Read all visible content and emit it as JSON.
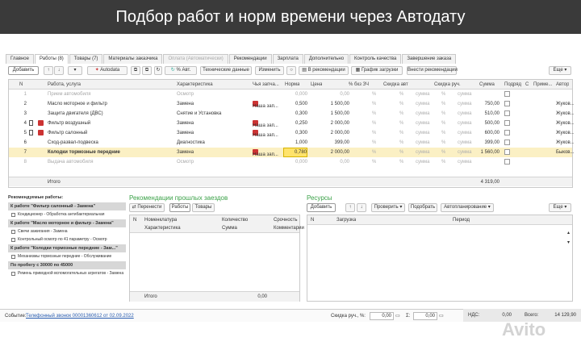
{
  "banner": {
    "title": "Подбор работ и норм времени через Автодату"
  },
  "tabs": [
    "Главное",
    "Работы (8)",
    "Товары (7)",
    "Материалы заказчика",
    "Оплата (Автоматически)",
    "Рекомендации",
    "Зарплата",
    "Дополнительно",
    "Контроль качества",
    "Завершение заказа"
  ],
  "toolbar": {
    "add": "Добавить",
    "autodata": "Autodata",
    "pct": "% Авт.",
    "tech": "Технические данные",
    "change": "Изменить",
    "to_recs": "В рекомендации",
    "schedule": "График загрузки",
    "bring": "Внести рекомендации",
    "more": "Еще"
  },
  "grid": {
    "headers": [
      "N",
      "Работа, услуга",
      "Характеристика",
      "Чья запча...",
      "Норма",
      "Цена",
      "% бкз ЗЧ",
      "Скидка авт",
      "Скидка руч.",
      "Сумма",
      "Подряд",
      "С",
      "Приме...",
      "Автор"
    ],
    "rows": [
      {
        "n": "1",
        "name": "Прием автомобиля",
        "char": "Осмотр",
        "whose": "",
        "norm": "0,000",
        "price": "0,00",
        "pct": "%",
        "disc": "%",
        "sum_auto": "сумма",
        "disc_man": "%",
        "sum_man": "сумма",
        "sum": "",
        "author": ""
      },
      {
        "n": "2",
        "name": "Масло моторное и фильтр",
        "char": "Замена",
        "whose": "Наша зап...",
        "norm": "0,500",
        "price": "1 500,00",
        "pct": "%",
        "disc": "%",
        "sum_auto": "сумма",
        "disc_man": "%",
        "sum_man": "сумма",
        "sum": "750,00",
        "author": "Жуков..."
      },
      {
        "n": "3",
        "name": "Защита двигателя (ДВС)",
        "char": "Снятие и Установка",
        "whose": "",
        "norm": "0,300",
        "price": "1 500,00",
        "pct": "%",
        "disc": "%",
        "sum_auto": "сумма",
        "disc_man": "%",
        "sum_man": "сумма",
        "sum": "510,00",
        "author": "Жуков..."
      },
      {
        "n": "4",
        "name": "Фильтр воздушный",
        "char": "Замена",
        "whose": "Наша зап...",
        "norm": "0,250",
        "price": "2 000,00",
        "pct": "%",
        "disc": "%",
        "sum_auto": "сумма",
        "disc_man": "%",
        "sum_man": "сумма",
        "sum": "500,00",
        "author": "Жуков..."
      },
      {
        "n": "5",
        "name": "Фильтр салонный",
        "char": "Замена",
        "whose": "Наша зап...",
        "norm": "0,300",
        "price": "2 000,00",
        "pct": "%",
        "disc": "%",
        "sum_auto": "сумма",
        "disc_man": "%",
        "sum_man": "сумма",
        "sum": "600,00",
        "author": "Жуков..."
      },
      {
        "n": "6",
        "name": "Сход-развал-подвеска",
        "char": "Диагностика",
        "whose": "",
        "norm": "1,000",
        "price": "399,00",
        "pct": "%",
        "disc": "%",
        "sum_auto": "сумма",
        "disc_man": "%",
        "sum_man": "сумма",
        "sum": "399,00",
        "author": "Жуков..."
      },
      {
        "n": "7",
        "name": "Колодки тормозные передние",
        "char": "Замена",
        "whose": "Наша зап...",
        "norm": "0,780",
        "price": "2 000,00",
        "pct": "%",
        "disc": "%",
        "sum_auto": "сумма",
        "disc_man": "%",
        "sum_man": "сумма",
        "sum": "1 560,00",
        "author": "Быков..."
      },
      {
        "n": "8",
        "name": "Выдача автомобиля",
        "char": "Осмотр",
        "whose": "",
        "norm": "0,000",
        "price": "0,00",
        "pct": "%",
        "disc": "%",
        "sum_auto": "сумма",
        "disc_man": "%",
        "sum_man": "сумма",
        "sum": "",
        "author": ""
      }
    ],
    "total_label": "Итого",
    "total_value": "4 319,00"
  },
  "recs": {
    "title": "Рекомендуемые работы:",
    "groups": [
      {
        "title": "К работе \"Фильтр салонный - Замена\"",
        "items": [
          "Кондиционер - Обработка антибактериальная"
        ]
      },
      {
        "title": "К работе \"Масло моторное и фильтр - Замена\"",
        "items": [
          "Свечи зажигания - Замена",
          "Контрольный осмотр по 41 параметру - Осмотр"
        ]
      },
      {
        "title": "К работе \"Колодки тормозные передние - Зам...\"",
        "items": [
          "Механизмы тормозные передние - Обслуживание"
        ]
      },
      {
        "title": "По пробегу с 30000 по 45000",
        "items": [
          "Ремень приводной вспомогательных агрегатов - Замена"
        ]
      }
    ]
  },
  "past": {
    "title": "Рекомендации прошлых заездов",
    "transfer": "Перенести",
    "works": "Работы",
    "goods": "Товары",
    "headers": [
      "N",
      "Номенклатура",
      "Количество",
      "Срочность"
    ],
    "headers2": [
      "Характеристика",
      "Сумма",
      "Комментарии"
    ],
    "total_label": "Итого",
    "total_value": "0,00"
  },
  "resources": {
    "title": "Ресурсы",
    "add": "Добавить",
    "check": "Проверить",
    "pick": "Подобрать",
    "autoplan": "Автопланирование",
    "more": "Еще",
    "headers": [
      "N",
      "Загрузка",
      "Период"
    ]
  },
  "status": {
    "event_label": "Событие:",
    "event_link": "Телефонный звонок 00001360612 от 02.09.2022",
    "disc_label": "Скидка руч., %:",
    "disc_value": "0,00",
    "sum_label": "Σ:",
    "sum_value": "0,00",
    "vat_label": "НДС:",
    "vat_value": "0,00",
    "total_label": "Всего:",
    "total_value": "14 129,90"
  },
  "watermark": "Avito"
}
